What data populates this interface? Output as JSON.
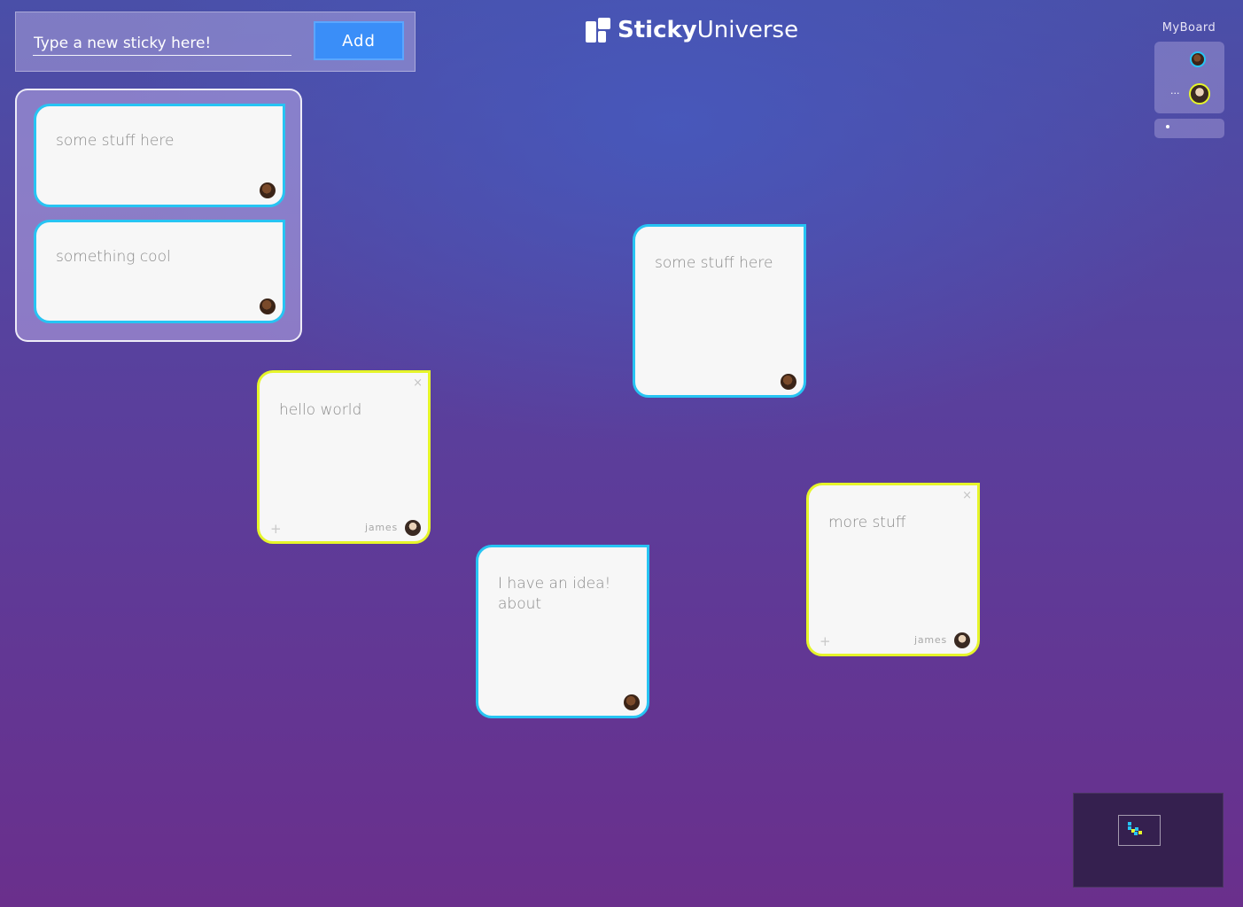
{
  "composer": {
    "placeholder": "Type a new sticky here!",
    "add_label": "Add"
  },
  "logo": {
    "name_bold": "Sticky",
    "name_light": "Universe"
  },
  "board": {
    "title": "MyBoard",
    "more_members": "...",
    "member_avatars": [
      "user-avatar",
      "james-avatar"
    ]
  },
  "stickies": [
    {
      "text": "some stuff here",
      "color": "#27c4f3",
      "in_group": true
    },
    {
      "text": "something cool",
      "color": "#27c4f3",
      "in_group": true
    },
    {
      "text": "some stuff here",
      "color": "#27c4f3",
      "in_group": false
    },
    {
      "text": "hello world",
      "color": "#e6f52a",
      "author": "james",
      "in_group": false
    },
    {
      "text": "I have an idea!\nabout",
      "color": "#27c4f3",
      "in_group": false
    },
    {
      "text": "more stuff",
      "color": "#e6f52a",
      "author": "james",
      "in_group": false
    }
  ],
  "icons": {
    "close": "×",
    "add": "+"
  },
  "colors": {
    "mine": "#27c4f3",
    "others": "#e6f52a",
    "add_button": "#3a8ef8"
  }
}
